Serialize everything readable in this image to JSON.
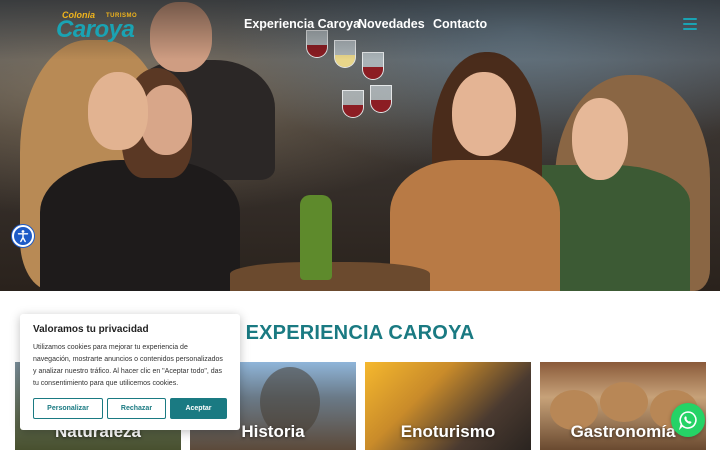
{
  "header": {
    "logo": {
      "line1": "Colonia",
      "line2": "Caroya",
      "tag": "TURISMO"
    },
    "nav": [
      {
        "label": "Experiencia Caroya"
      },
      {
        "label": "Novedades"
      },
      {
        "label": "Contacto"
      }
    ],
    "menu_icon": "hamburger-icon"
  },
  "hero": {
    "image": "friends-toasting-with-wine-photo"
  },
  "accessibility_icon": "accessibility-icon",
  "section": {
    "title": "EXPERIENCIA CAROYA",
    "cards": [
      {
        "label": "Naturaleza"
      },
      {
        "label": "Historia"
      },
      {
        "label": "Enoturismo"
      },
      {
        "label": "Gastronomía"
      }
    ]
  },
  "cookie": {
    "title": "Valoramos tu privacidad",
    "body": "Utilizamos cookies para mejorar tu experiencia de navegación, mostrarte anuncios o contenidos personalizados y analizar nuestro tráfico. Al hacer clic en \"Aceptar todo\", das tu consentimiento para que utilicemos cookies.",
    "buttons": {
      "customize": "Personalizar",
      "reject": "Rechazar",
      "accept": "Aceptar"
    }
  },
  "whatsapp_icon": "whatsapp-icon",
  "colors": {
    "brand_teal": "#1a7a82",
    "logo_cyan": "#1aa3b3",
    "logo_yellow": "#f0b41c",
    "whatsapp": "#25d366"
  }
}
